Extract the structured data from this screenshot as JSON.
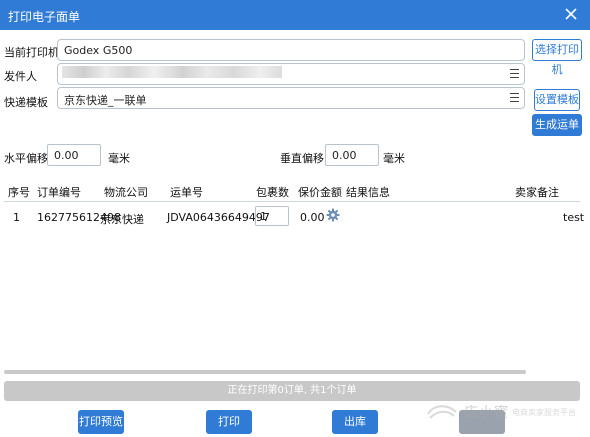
{
  "window": {
    "title": "打印电子面单"
  },
  "form": {
    "printer_label": "当前打印机",
    "printer_value": "Godex G500",
    "choose_printer": "选择打印机",
    "sender_label": "发件人",
    "template_label": "快递模板",
    "template_value": "京东快递_一联单",
    "set_template": "设置模板",
    "gen_waybill": "生成运单号",
    "h_offset_label": "水平偏移",
    "h_offset_value": "0.00",
    "h_unit": "毫米",
    "v_offset_label": "垂直偏移",
    "v_offset_value": "0.00",
    "v_unit": "毫米"
  },
  "table": {
    "headers": [
      "序号",
      "订单编号",
      "物流公司",
      "运单号",
      "包裹数",
      "保价金额",
      "结果信息",
      "卖家备注"
    ],
    "rows": [
      {
        "index": "1",
        "order_no": "162775612498",
        "carrier": "京东快递",
        "waybill": "JDVA06436649497",
        "packages": "1",
        "insured": "0.00",
        "result": "",
        "remark": "test"
      }
    ]
  },
  "status": {
    "text": "正在打印第0订单, 共1个订单",
    "progress": 0
  },
  "footer": {
    "preview": "打印预览",
    "print": "打印",
    "outbound": "出库"
  },
  "watermark": {
    "brand": "店小蜜",
    "sub": "电商卖家服务平台"
  },
  "colors": {
    "accent": "#2f7bd6"
  },
  "icons": [
    "close-icon",
    "menu-lines-icon",
    "gear-icon",
    "logo-icon"
  ]
}
